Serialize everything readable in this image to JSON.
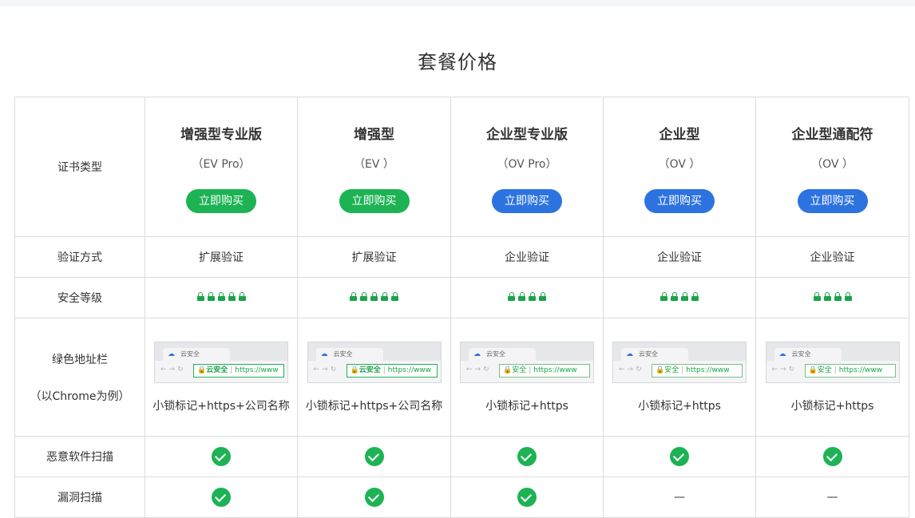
{
  "title": "套餐价格",
  "row_labels": {
    "type": "证书类型",
    "verify": "验证方式",
    "level": "安全等级",
    "bar_line1": "绿色地址栏",
    "bar_line2": "（以Chrome为例）",
    "malware": "恶意软件扫描",
    "vuln": "漏洞扫描"
  },
  "buy_label": "立即购买",
  "browser": {
    "tab_text": "云安全",
    "nav": "←→↻",
    "company_name": "云安全",
    "secure_text": "安全",
    "url_text": "https://www"
  },
  "products": [
    {
      "name": "增强型专业版",
      "code": "（EV Pro）",
      "button_color": "green",
      "verify": "扩展验证",
      "lock_count": 5,
      "bar_type": "ev",
      "bar_desc": "小锁标记+https+公司名称",
      "malware": "check",
      "vuln": "check"
    },
    {
      "name": "增强型",
      "code": "（EV ）",
      "button_color": "green",
      "verify": "扩展验证",
      "lock_count": 5,
      "bar_type": "ev",
      "bar_desc": "小锁标记+https+公司名称",
      "malware": "check",
      "vuln": "check"
    },
    {
      "name": "企业型专业版",
      "code": "（OV Pro）",
      "button_color": "blue",
      "verify": "企业验证",
      "lock_count": 4,
      "bar_type": "ov",
      "bar_desc": "小锁标记+https",
      "malware": "check",
      "vuln": "check"
    },
    {
      "name": "企业型",
      "code": "（OV ）",
      "button_color": "blue",
      "verify": "企业验证",
      "lock_count": 4,
      "bar_type": "ov",
      "bar_desc": "小锁标记+https",
      "malware": "check",
      "vuln": "—"
    },
    {
      "name": "企业型通配符",
      "code": "（OV ）",
      "button_color": "blue",
      "verify": "企业验证",
      "lock_count": 4,
      "bar_type": "ov",
      "bar_desc": "小锁标记+https",
      "malware": "check",
      "vuln": "—"
    }
  ],
  "colors": {
    "green": "#1db354",
    "blue": "#2d73e0",
    "border": "#dcdcdc"
  }
}
